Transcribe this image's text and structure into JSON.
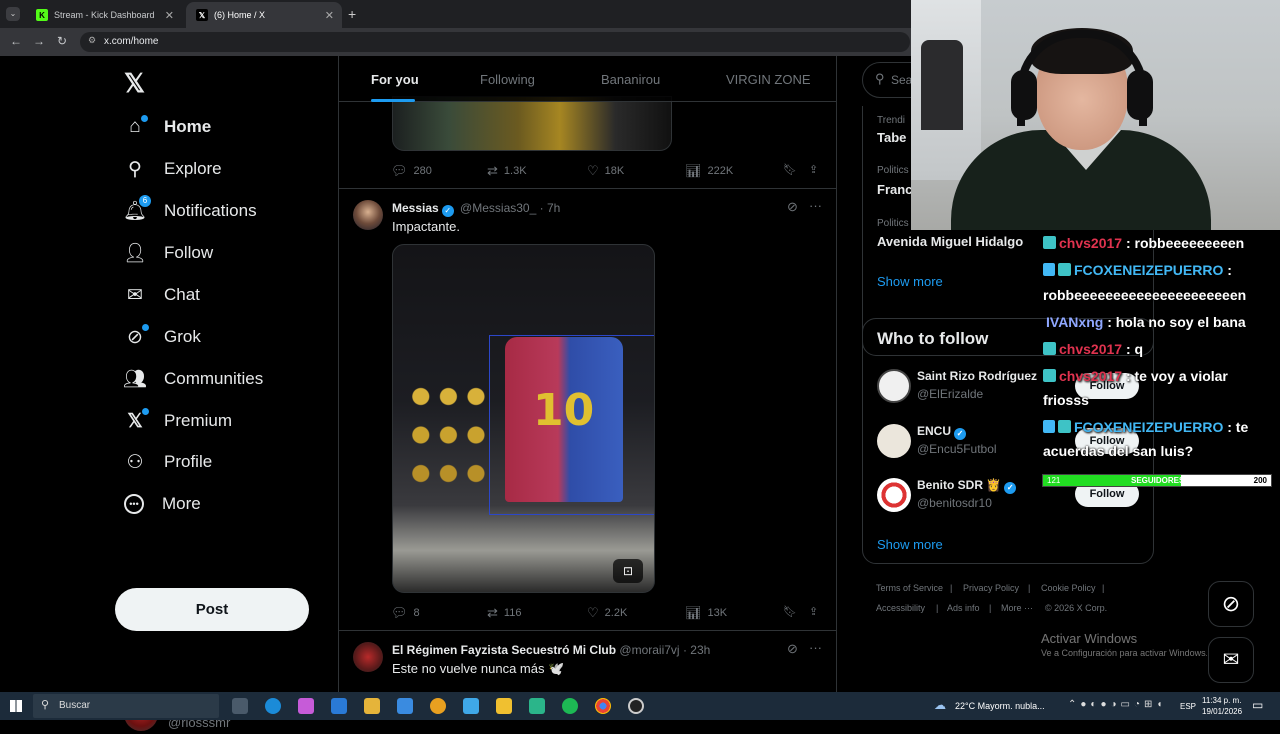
{
  "browser": {
    "tabs": [
      {
        "title": "Stream - Kick Dashboard",
        "active": false
      },
      {
        "title": "(6) Home / X",
        "active": true
      }
    ],
    "url": "x.com/home"
  },
  "nav": {
    "items": [
      {
        "label": "Home",
        "icon": "home-icon"
      },
      {
        "label": "Explore",
        "icon": "search-icon"
      },
      {
        "label": "Notifications",
        "icon": "bell-icon",
        "badge": "6"
      },
      {
        "label": "Follow",
        "icon": "person-plus-icon"
      },
      {
        "label": "Chat",
        "icon": "mail-icon"
      },
      {
        "label": "Grok",
        "icon": "grok-icon"
      },
      {
        "label": "Communities",
        "icon": "people-icon"
      },
      {
        "label": "Premium",
        "icon": "x-logo-icon"
      },
      {
        "label": "Profile",
        "icon": "person-icon"
      },
      {
        "label": "More",
        "icon": "more-circle-icon"
      }
    ],
    "post_label": "Post",
    "account": {
      "name": "riosssmr",
      "handle": "@riosssmr"
    }
  },
  "feed": {
    "tabs": [
      "For you",
      "Following",
      "Bananirou",
      "VIRGIN ZONE"
    ],
    "tweet0_stats": {
      "replies": "280",
      "reposts": "1.3K",
      "likes": "18K",
      "views": "222K"
    },
    "tweet1": {
      "name": "Messias",
      "handle": "@Messias30_",
      "time": "7h",
      "text": "Impactante.",
      "stats": {
        "replies": "8",
        "reposts": "116",
        "likes": "2.2K",
        "views": "13K"
      }
    },
    "tweet2": {
      "name": "El Régimen Fayzista Secuestró Mi Club",
      "handle": "@moraii7vj",
      "time": "23h",
      "text": "Este no vuelve nunca más 🕊️"
    }
  },
  "right": {
    "search_placeholder": "Sea",
    "trends": [
      {
        "meta": "Trendi",
        "name": "Tabe"
      },
      {
        "meta": "Politics",
        "name": "Franci"
      },
      {
        "meta": "Politics · Trending",
        "name": "Avenida Miguel Hidalgo"
      }
    ],
    "show_more": "Show more",
    "who_to_follow_title": "Who to follow",
    "who_to_follow": [
      {
        "name": "Saint Rizo Rodríguez",
        "handle": "@ElErizalde",
        "button": "Follow"
      },
      {
        "name": "ENCU",
        "handle": "@Encu5Futbol",
        "button": "Follow"
      },
      {
        "name": "Benito SDR 👸",
        "handle": "@benitosdr10",
        "button": "Follow"
      }
    ],
    "footer": [
      "Terms of Service",
      "Privacy Policy",
      "Cookie Policy",
      "Accessibility",
      "Ads info",
      "More ···",
      "© 2026 X Corp."
    ]
  },
  "chat": [
    {
      "user": "chvs2017",
      "msg": " : robbeeeeeeeeen",
      "color": "#e0334f"
    },
    {
      "user": "FCOXENEIZEPUERRO",
      "msg": " :",
      "color": "#42b8f5"
    },
    {
      "user": "",
      "msg": "robbeeeeeeeeeeeeeeeeeeeeen",
      "color": "#ffffff"
    },
    {
      "user": "IVANxng",
      "msg": " : hola no soy el bana",
      "color": "#8fa7ff"
    },
    {
      "user": "chvs2017",
      "msg": " : q",
      "color": "#e0334f"
    },
    {
      "user": "chvs2017",
      "msg": " : te voy a violar",
      "color": "#e0334f"
    },
    {
      "user": "",
      "msg": "friosss",
      "color": "#ffffff"
    },
    {
      "user": "FCOXENEIZEPUERRO",
      "msg": " : te",
      "color": "#42b8f5"
    },
    {
      "user": "",
      "msg": "acuerdas del san luis?",
      "color": "#ffffff"
    }
  ],
  "follower_goal": {
    "current": "121",
    "label": "SEGUIDORES",
    "target": "200",
    "progress": 0.605
  },
  "windows": {
    "activate_title": "Activar Windows",
    "activate_sub": "Ve a Configuración para activar Windows.",
    "search_placeholder": "Buscar",
    "weather": "22°C  Mayorm. nubla...",
    "lang": "ESP",
    "time": "11:34 p. m.",
    "date": "19/01/2026"
  }
}
